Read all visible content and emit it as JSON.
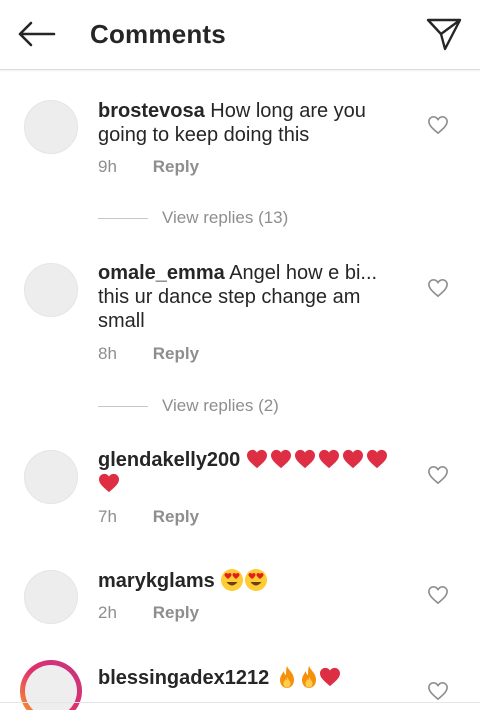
{
  "header": {
    "title": "Comments"
  },
  "comments": [
    {
      "username": "brostevosa",
      "text": "How long are you going to keep doing this",
      "time": "9h",
      "reply_label": "Reply",
      "view_replies": "View replies (13)"
    },
    {
      "username": "omale_emma",
      "text": "Angel how e bi... this ur dance step change am small",
      "time": "8h",
      "reply_label": "Reply",
      "view_replies": "View replies (2)"
    },
    {
      "username": "glendakelly200",
      "text": "",
      "emojis": [
        "red-heart",
        "red-heart",
        "red-heart",
        "red-heart",
        "red-heart",
        "red-heart",
        "red-heart"
      ],
      "time": "7h",
      "reply_label": "Reply"
    },
    {
      "username": "marykglams",
      "text": "",
      "emojis": [
        "heart-eyes-face",
        "heart-eyes-face"
      ],
      "time": "2h",
      "reply_label": "Reply"
    },
    {
      "username": "blessingadex1212",
      "text": "",
      "emojis": [
        "fire",
        "fire",
        "red-heart"
      ]
    }
  ],
  "icons": {
    "back": "arrow-left-icon",
    "send": "paper-plane-icon",
    "like": "heart-outline-icon"
  },
  "colors": {
    "text": "#262626",
    "secondary": "#8e8e8e",
    "heart": "#e0201e"
  }
}
